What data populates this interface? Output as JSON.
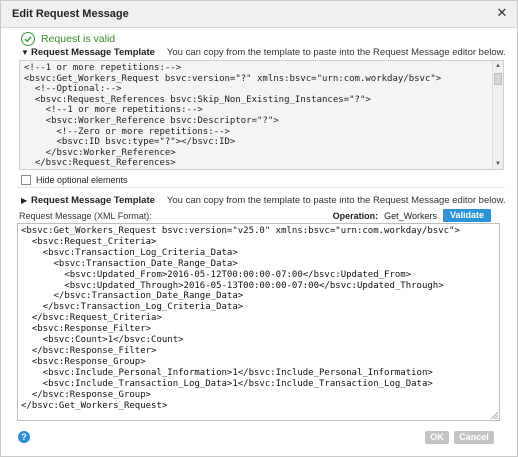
{
  "dialog": {
    "title": "Edit Request Message",
    "close_icon": "close-icon"
  },
  "status": {
    "text": "Request is valid",
    "color": "#3a8a2a"
  },
  "template_section": {
    "title": "Request Message Template",
    "hint": "You can copy from the template to paste into the Request Message editor below.",
    "lines": [
      "<!--1 or more repetitions:-->",
      "<bsvc:Get_Workers_Request bsvc:version=\"?\" xmlns:bsvc=\"urn:com.workday/bsvc\">",
      "  <!--Optional:-->",
      "  <bsvc:Request_References bsvc:Skip_Non_Existing_Instances=\"?\">",
      "    <!--1 or more repetitions:-->",
      "    <bsvc:Worker_Reference bsvc:Descriptor=\"?\">",
      "      <!--Zero or more repetitions:-->",
      "      <bsvc:ID bsvc:type=\"?\"></bsvc:ID>",
      "    </bsvc:Worker_Reference>",
      "  </bsvc:Request_References>"
    ]
  },
  "hide_optional": {
    "label": "Hide optional elements",
    "checked": false
  },
  "collapsed_section": {
    "title": "Request Message Template",
    "hint": "You can copy from the template to paste into the Request Message editor below."
  },
  "request_message": {
    "label": "Request Message (XML Format):",
    "operation_label": "Operation:",
    "operation_value": "Get_Workers",
    "validate_label": "Validate",
    "lines": [
      "<bsvc:Get_Workers_Request bsvc:version=\"v25.0\" xmlns:bsvc=\"urn:com.workday/bsvc\">",
      "  <bsvc:Request_Criteria>",
      "    <bsvc:Transaction_Log_Criteria_Data>",
      "      <bsvc:Transaction_Date_Range_Data>",
      "        <bsvc:Updated_From>2016-05-12T00:00:00-07:00</bsvc:Updated_From>",
      "        <bsvc:Updated_Through>2016-05-13T00:00:00-07:00</bsvc:Updated_Through>",
      "      </bsvc:Transaction_Date_Range_Data>",
      "    </bsvc:Transaction_Log_Criteria_Data>",
      "  </bsvc:Request_Criteria>",
      "  <bsvc:Response_Filter>",
      "    <bsvc:Count>1</bsvc:Count>",
      "  </bsvc:Response_Filter>",
      "  <bsvc:Response_Group>",
      "    <bsvc:Include_Personal_Information>1</bsvc:Include_Personal_Information>",
      "    <bsvc:Include_Transaction_Log_Data>1</bsvc:Include_Transaction_Log_Data>",
      "  </bsvc:Response_Group>",
      "</bsvc:Get_Workers_Request>"
    ]
  },
  "footer": {
    "help_glyph": "?",
    "ok_label": "OK",
    "cancel_label": "Cancel"
  },
  "colors": {
    "accent": "#2b93d8",
    "valid_green": "#3a9a3a",
    "disabled_button": "#c4c4c4"
  }
}
